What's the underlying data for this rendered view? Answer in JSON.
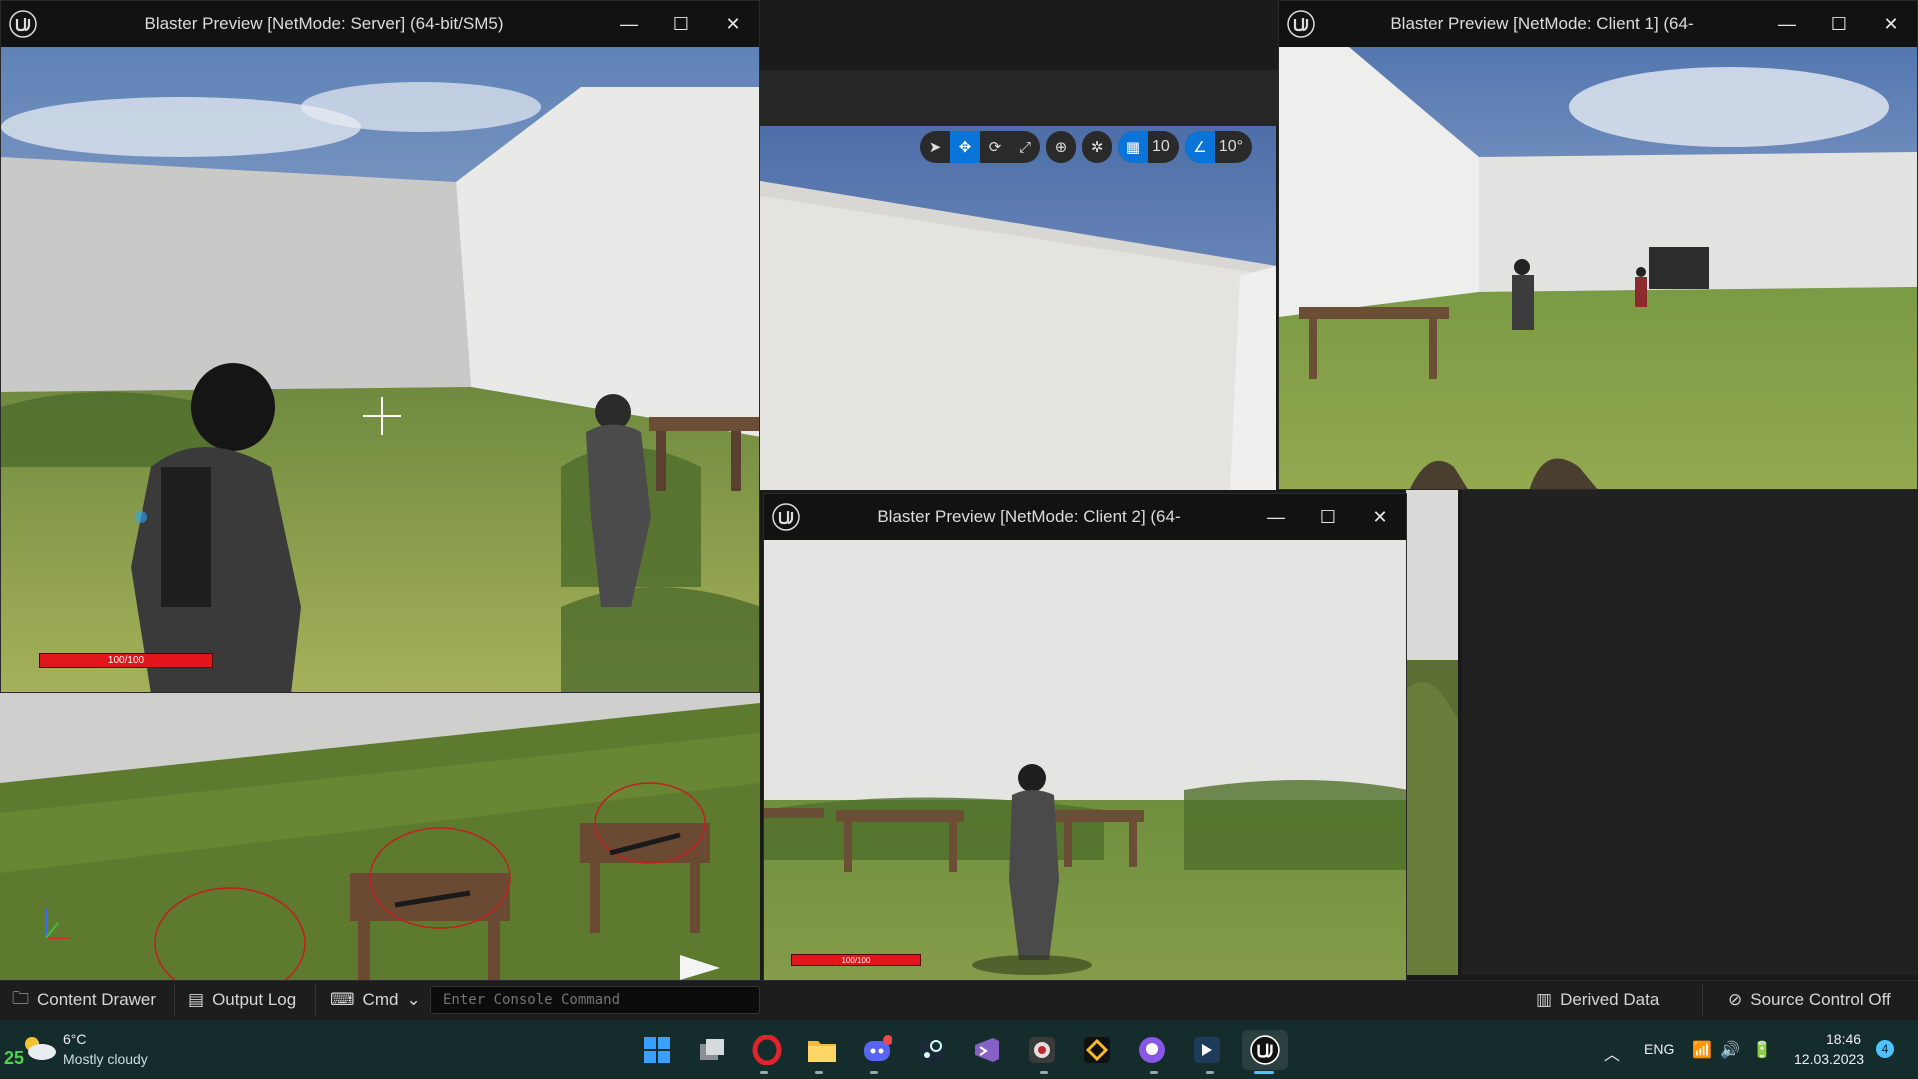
{
  "windows": {
    "server": {
      "title": "Blaster Preview [NetMode: Server]  (64-bit/SM5)",
      "health": "100/100"
    },
    "client1": {
      "title": "Blaster Preview [NetMode: Client 1]  (64-"
    },
    "client2": {
      "title": "Blaster Preview [NetMode: Client 2]  (64-",
      "health": "100/100"
    }
  },
  "viewport_toolbar": {
    "grid_value": "10",
    "rotation_value": "10°"
  },
  "editor_bottom": {
    "content_drawer": "Content Drawer",
    "output_log": "Output Log",
    "cmd": "Cmd",
    "console_placeholder": "Enter Console Command",
    "derived_data": "Derived Data",
    "source_control": "Source Control Off"
  },
  "taskbar": {
    "weather_temp": "6°C",
    "weather_desc": "Mostly cloudy",
    "weather_badge": "25",
    "language": "ENG",
    "time": "18:46",
    "date": "12.03.2023",
    "notification_count": "4"
  },
  "colors": {
    "accent": "#0b74d8",
    "health": "#e2151b",
    "taskbar": "#152c2c"
  }
}
